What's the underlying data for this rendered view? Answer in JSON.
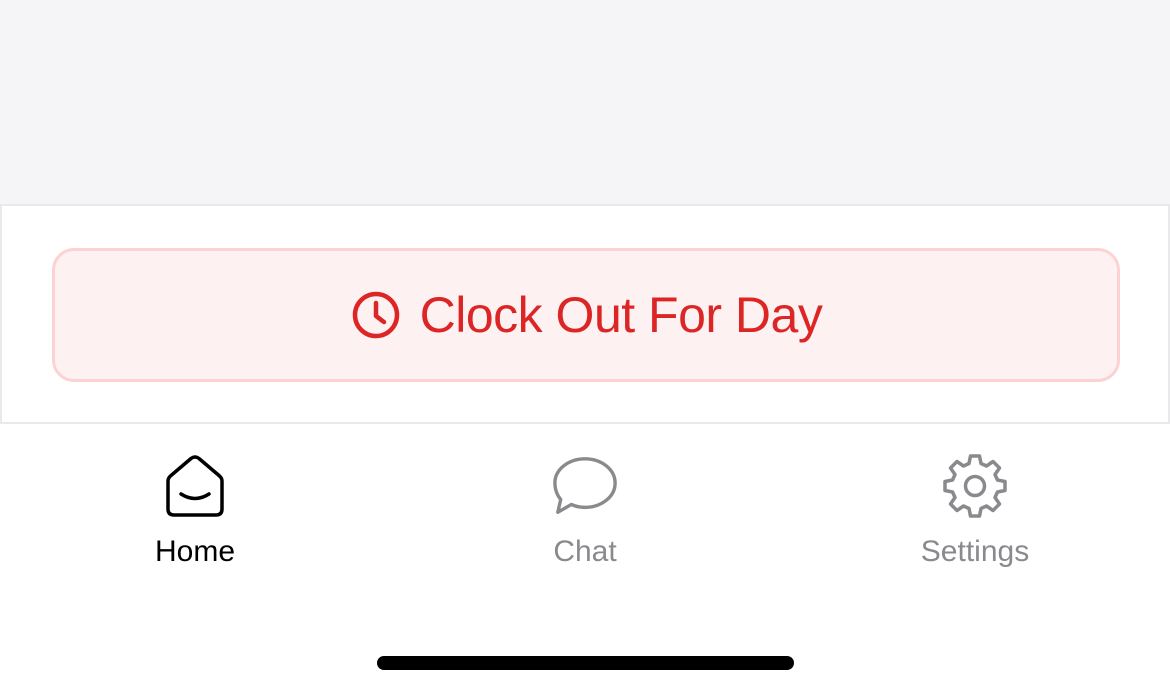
{
  "colors": {
    "danger_text": "#dc2626",
    "danger_bg": "#fef1f2",
    "danger_border": "#fcd2d3",
    "tab_active": "#000000",
    "tab_inactive": "#8a8a8e",
    "content_bg": "#f5f5f7"
  },
  "action": {
    "clock_out_label": "Clock Out For Day",
    "icon": "clock-icon"
  },
  "tabs": [
    {
      "label": "Home",
      "icon": "home-icon",
      "active": true
    },
    {
      "label": "Chat",
      "icon": "chat-bubble-icon",
      "active": false
    },
    {
      "label": "Settings",
      "icon": "gear-icon",
      "active": false
    }
  ]
}
